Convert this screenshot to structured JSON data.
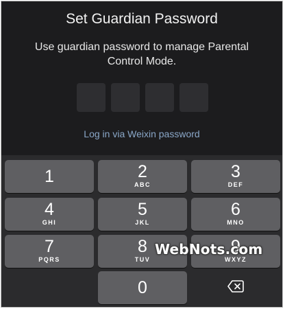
{
  "title": "Set Guardian Password",
  "subtitle": "Use guardian password to manage Parental Control Mode.",
  "pin": {
    "length": 4,
    "filled": 0
  },
  "alt_login": "Log in via Weixin password",
  "keypad": {
    "keys": [
      {
        "digit": "1",
        "letters": ""
      },
      {
        "digit": "2",
        "letters": "ABC"
      },
      {
        "digit": "3",
        "letters": "DEF"
      },
      {
        "digit": "4",
        "letters": "GHI"
      },
      {
        "digit": "5",
        "letters": "JKL"
      },
      {
        "digit": "6",
        "letters": "MNO"
      },
      {
        "digit": "7",
        "letters": "PQRS"
      },
      {
        "digit": "8",
        "letters": "TUV"
      },
      {
        "digit": "9",
        "letters": "WXYZ"
      },
      {
        "digit": "0",
        "letters": ""
      }
    ],
    "delete_icon": "backspace-icon"
  },
  "watermark": "WebNots.com",
  "colors": {
    "background": "#1c1c1e",
    "keypad_background": "#2b2b2d",
    "key": "#5f5f62",
    "pin_box": "#2e2e31",
    "link": "#8aa7c8"
  }
}
